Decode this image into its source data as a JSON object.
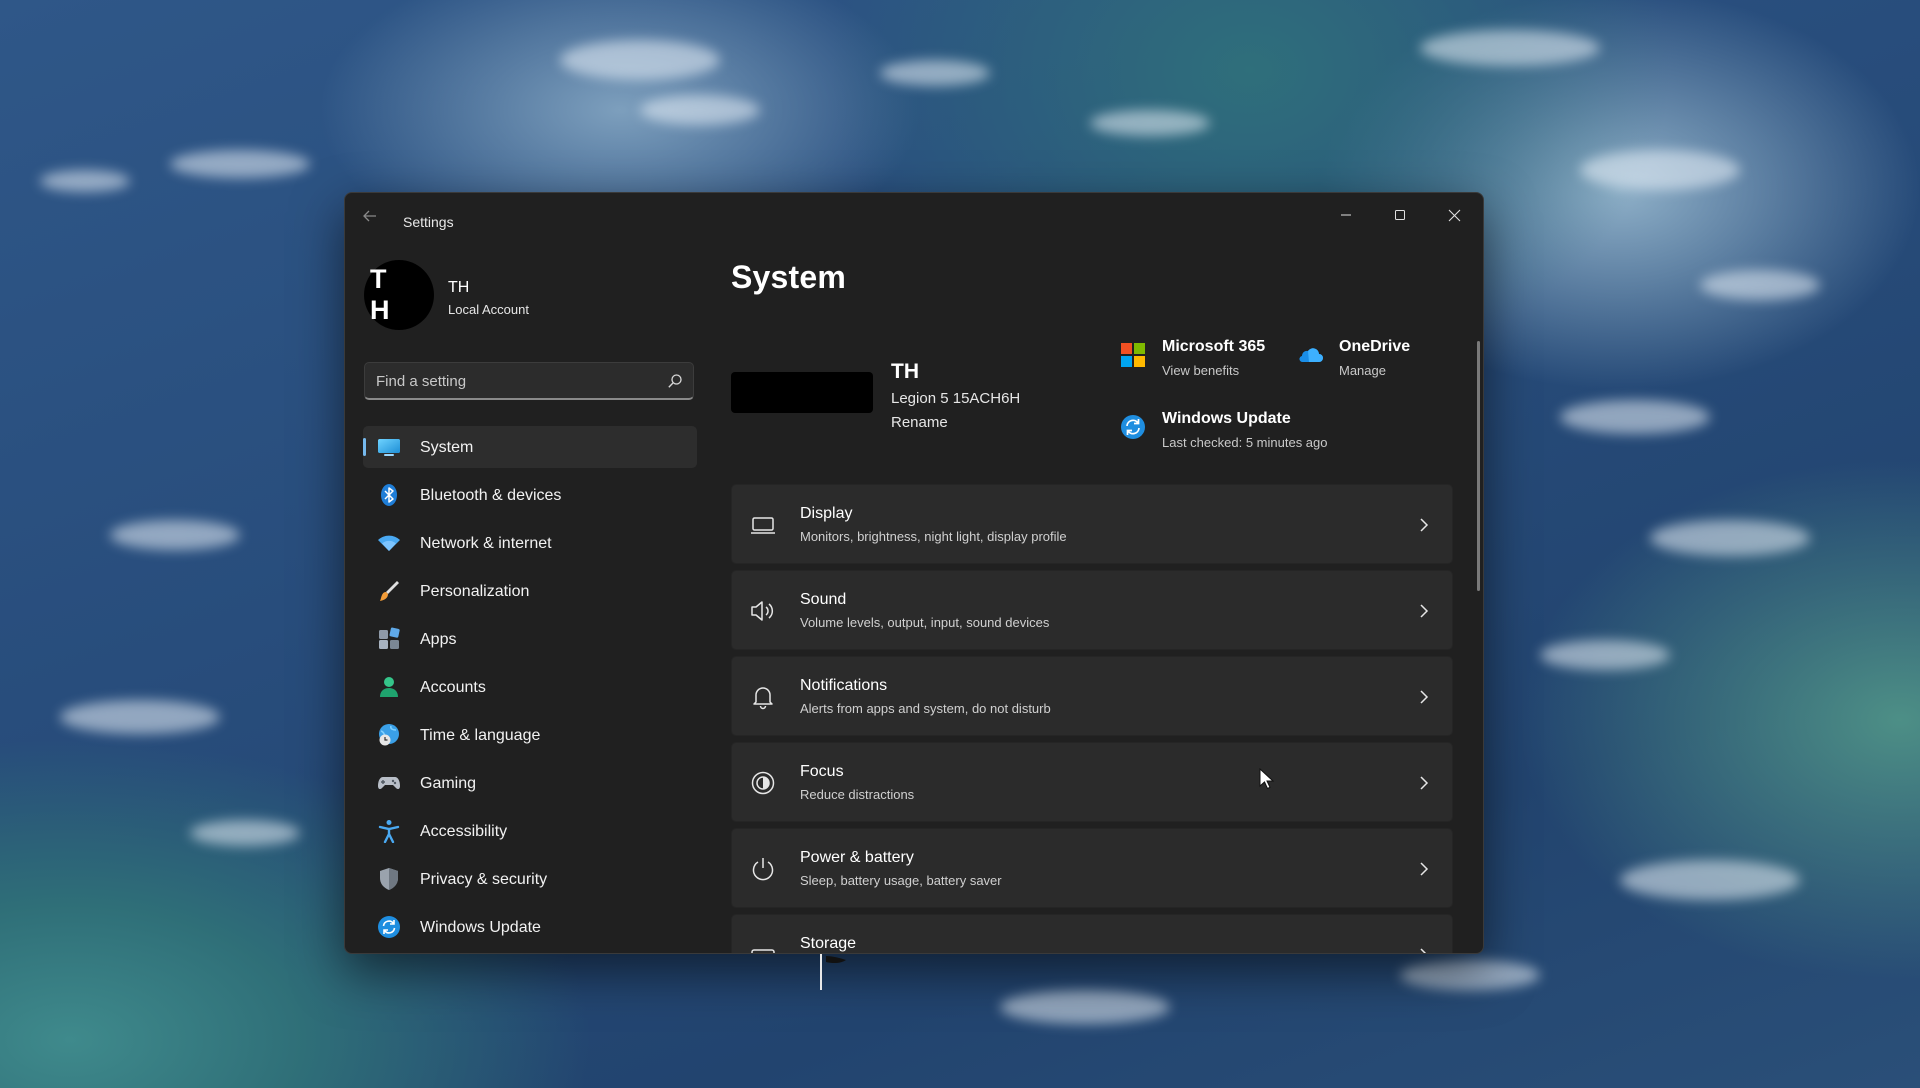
{
  "window": {
    "title": "Settings"
  },
  "user": {
    "initials": "T H",
    "name": "TH",
    "account_type": "Local Account"
  },
  "search": {
    "placeholder": "Find a setting"
  },
  "nav": {
    "items": [
      {
        "label": "System",
        "icon": "system-icon",
        "selected": true
      },
      {
        "label": "Bluetooth & devices",
        "icon": "bluetooth-icon"
      },
      {
        "label": "Network & internet",
        "icon": "wifi-icon"
      },
      {
        "label": "Personalization",
        "icon": "brush-icon"
      },
      {
        "label": "Apps",
        "icon": "apps-icon"
      },
      {
        "label": "Accounts",
        "icon": "person-icon"
      },
      {
        "label": "Time & language",
        "icon": "globe-clock-icon"
      },
      {
        "label": "Gaming",
        "icon": "gamepad-icon"
      },
      {
        "label": "Accessibility",
        "icon": "accessibility-icon"
      },
      {
        "label": "Privacy & security",
        "icon": "shield-icon"
      },
      {
        "label": "Windows Update",
        "icon": "update-icon"
      }
    ]
  },
  "main": {
    "title": "System",
    "device": {
      "name": "TH",
      "model": "Legion 5 15ACH6H",
      "rename_label": "Rename"
    },
    "quick_links": [
      {
        "title": "Microsoft 365",
        "subtitle": "View benefits",
        "icon": "microsoft-logo-icon"
      },
      {
        "title": "OneDrive",
        "subtitle": "Manage",
        "icon": "onedrive-cloud-icon"
      },
      {
        "title": "Windows Update",
        "subtitle": "Last checked: 5 minutes ago",
        "icon": "update-icon"
      }
    ],
    "cards": [
      {
        "title": "Display",
        "subtitle": "Monitors, brightness, night light, display profile",
        "icon": "monitor-icon"
      },
      {
        "title": "Sound",
        "subtitle": "Volume levels, output, input, sound devices",
        "icon": "speaker-icon"
      },
      {
        "title": "Notifications",
        "subtitle": "Alerts from apps and system, do not disturb",
        "icon": "bell-icon"
      },
      {
        "title": "Focus",
        "subtitle": "Reduce distractions",
        "icon": "focus-icon"
      },
      {
        "title": "Power & battery",
        "subtitle": "Sleep, battery usage, battery saver",
        "icon": "power-icon"
      },
      {
        "title": "Storage",
        "subtitle": "",
        "icon": "storage-icon"
      }
    ]
  },
  "colors": {
    "accent": "#76b9ed",
    "window_bg": "#202020",
    "card_bg": "#2b2b2b"
  }
}
